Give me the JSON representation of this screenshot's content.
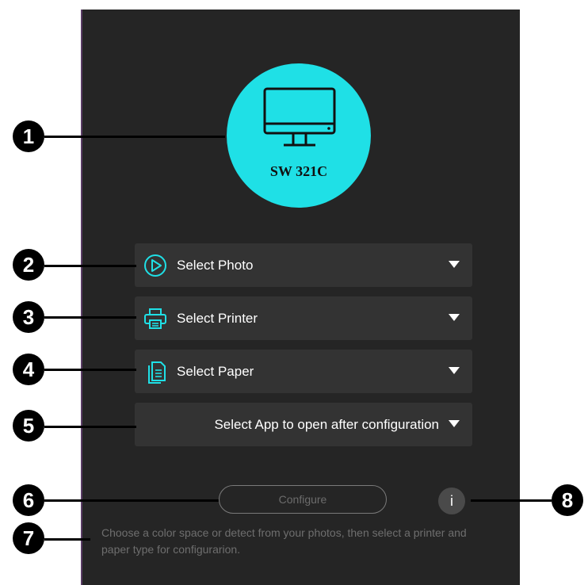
{
  "device": {
    "model": "SW 321C"
  },
  "selects": {
    "photo": "Select Photo",
    "printer": "Select Printer",
    "paper": "Select Paper",
    "app": "Select App to open after configuration"
  },
  "buttons": {
    "configure": "Configure",
    "info": "i"
  },
  "hint_text": "Choose a color space or detect from your photos, then select a printer and paper type for configurarion.",
  "callouts": [
    "1",
    "2",
    "3",
    "4",
    "5",
    "6",
    "7",
    "8"
  ],
  "colors": {
    "accent": "#1fe0e6",
    "panel": "#252525",
    "select_bg": "#333333"
  }
}
